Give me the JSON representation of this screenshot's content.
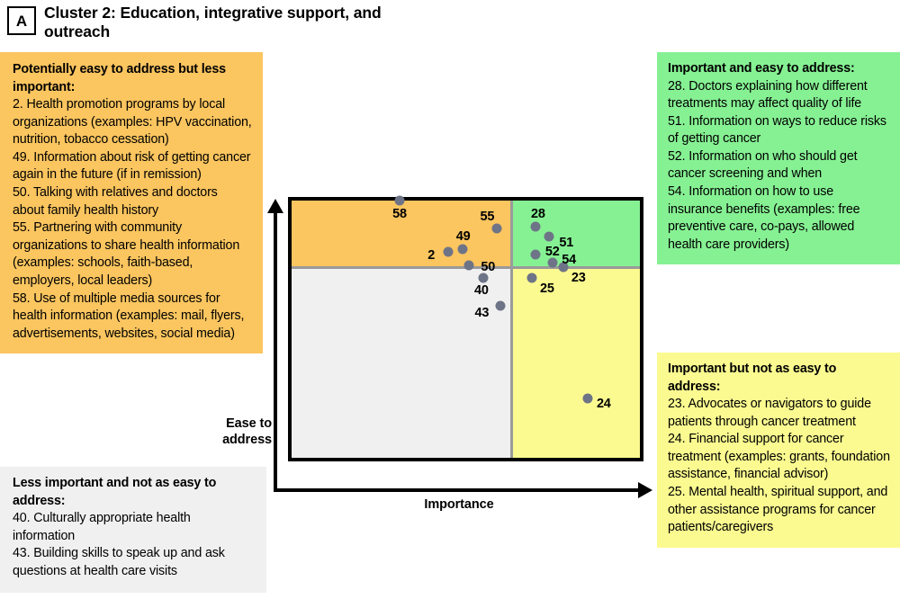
{
  "header": {
    "badge": "A",
    "title": "Cluster 2: Education, integrative support, and outreach"
  },
  "callouts": {
    "orange": {
      "title": "Potentially easy to address but less important:",
      "body": "2. Health promotion programs by local organizations (examples: HPV vaccination, nutrition, tobacco cessation)\n49. Information about risk of getting cancer again in the future (if in remission)\n50. Talking with relatives and doctors about family health history\n55. Partnering with community organizations to share health information (examples: schools, faith-based, employers, local leaders)\n58. Use of multiple media sources for health information (examples: mail, flyers, advertisements, websites, social media)"
    },
    "green": {
      "title": "Important and easy to address:",
      "body": "28. Doctors explaining how different treatments may affect quality of life\n51. Information on ways to reduce risks of getting cancer\n52. Information on who should get cancer screening and when\n54. Information on how to use insurance benefits (examples: free preventive care, co-pays, allowed health care providers)"
    },
    "yellow": {
      "title": "Important but not as easy to address:",
      "body": "23. Advocates or navigators to guide patients through cancer treatment\n24. Financial support for cancer treatment (examples: grants, foundation assistance, financial advisor)\n25. Mental health, spiritual support, and other assistance programs for cancer patients/caregivers"
    },
    "gray": {
      "title": "Less important and not as easy to address:",
      "body": "40. Culturally appropriate health information\n43. Building skills to speak up and ask questions at health care visits"
    }
  },
  "chart_data": {
    "type": "scatter",
    "title": "Cluster 2: Education, integrative support, and outreach",
    "xlabel": "Importance",
    "ylabel": "Ease to address",
    "xlim": [
      0,
      100
    ],
    "ylim": [
      0,
      100
    ],
    "grid": false,
    "legend": "none",
    "quadrants": [
      {
        "name": "top-left",
        "label": "Potentially easy to address but less important",
        "color": "#fbc55f"
      },
      {
        "name": "top-right",
        "label": "Important and easy to address",
        "color": "#86f193"
      },
      {
        "name": "bottom-left",
        "label": "Less important and not as easy to address",
        "color": "#f0f0f0"
      },
      {
        "name": "bottom-right",
        "label": "Important but not as easy to address",
        "color": "#fafa90"
      }
    ],
    "quadrant_split": {
      "x": 62,
      "y": 75
    },
    "point_color": "#6e7487",
    "points": [
      {
        "id": "58",
        "x": 31,
        "y": 100,
        "label_dx": 0,
        "label_dy": 15,
        "label_anchor": "center"
      },
      {
        "id": "55",
        "x": 59,
        "y": 89,
        "label_dx": -11,
        "label_dy": -13,
        "label_anchor": "center"
      },
      {
        "id": "49",
        "x": 49,
        "y": 81,
        "label_dx": 1,
        "label_dy": -14,
        "label_anchor": "center"
      },
      {
        "id": "2",
        "x": 45,
        "y": 80,
        "label_dx": -15,
        "label_dy": 4,
        "label_anchor": "right"
      },
      {
        "id": "50",
        "x": 51,
        "y": 75,
        "label_dx": 13,
        "label_dy": 2,
        "label_anchor": "left"
      },
      {
        "id": "28",
        "x": 70,
        "y": 90,
        "label_dx": 3,
        "label_dy": -14,
        "label_anchor": "center"
      },
      {
        "id": "51",
        "x": 74,
        "y": 86,
        "label_dx": 11,
        "label_dy": 7,
        "label_anchor": "left"
      },
      {
        "id": "52",
        "x": 70,
        "y": 79,
        "label_dx": 11,
        "label_dy": -3,
        "label_anchor": "left"
      },
      {
        "id": "54",
        "x": 75,
        "y": 76,
        "label_dx": 10,
        "label_dy": -3,
        "label_anchor": "left"
      },
      {
        "id": "23",
        "x": 78,
        "y": 74,
        "label_dx": 9,
        "label_dy": 12,
        "label_anchor": "left"
      },
      {
        "id": "25",
        "x": 69,
        "y": 70,
        "label_dx": 9,
        "label_dy": 12,
        "label_anchor": "left"
      },
      {
        "id": "40",
        "x": 55,
        "y": 70,
        "label_dx": -2,
        "label_dy": 14,
        "label_anchor": "center"
      },
      {
        "id": "43",
        "x": 60,
        "y": 59,
        "label_dx": -13,
        "label_dy": 8,
        "label_anchor": "right"
      },
      {
        "id": "24",
        "x": 85,
        "y": 23,
        "label_dx": 10,
        "label_dy": 6,
        "label_anchor": "left"
      }
    ]
  }
}
